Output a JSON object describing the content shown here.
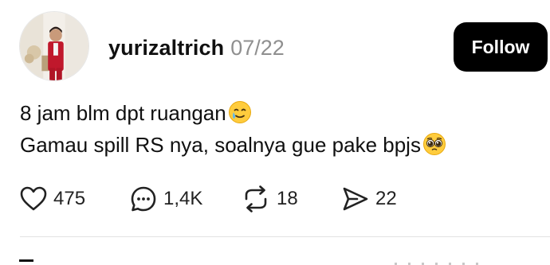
{
  "post": {
    "username": "yurizaltrich",
    "date": "07/22",
    "follow_label": "Follow",
    "content": {
      "line1": "8 jam blm dpt ruangan",
      "line1_emoji": "smiling-face-with-tear-icon",
      "line2": "Gamau spill RS nya, soalnya gue pake bpjs",
      "line2_emoji": "pleading-face-icon"
    },
    "actions": {
      "likes": "475",
      "comments": "1,4K",
      "reposts": "18",
      "shares": "22"
    }
  },
  "colors": {
    "text": "#101010",
    "muted": "#8f8f8f",
    "button_bg": "#000000",
    "button_text": "#ffffff",
    "divider": "#e2e2e2"
  }
}
